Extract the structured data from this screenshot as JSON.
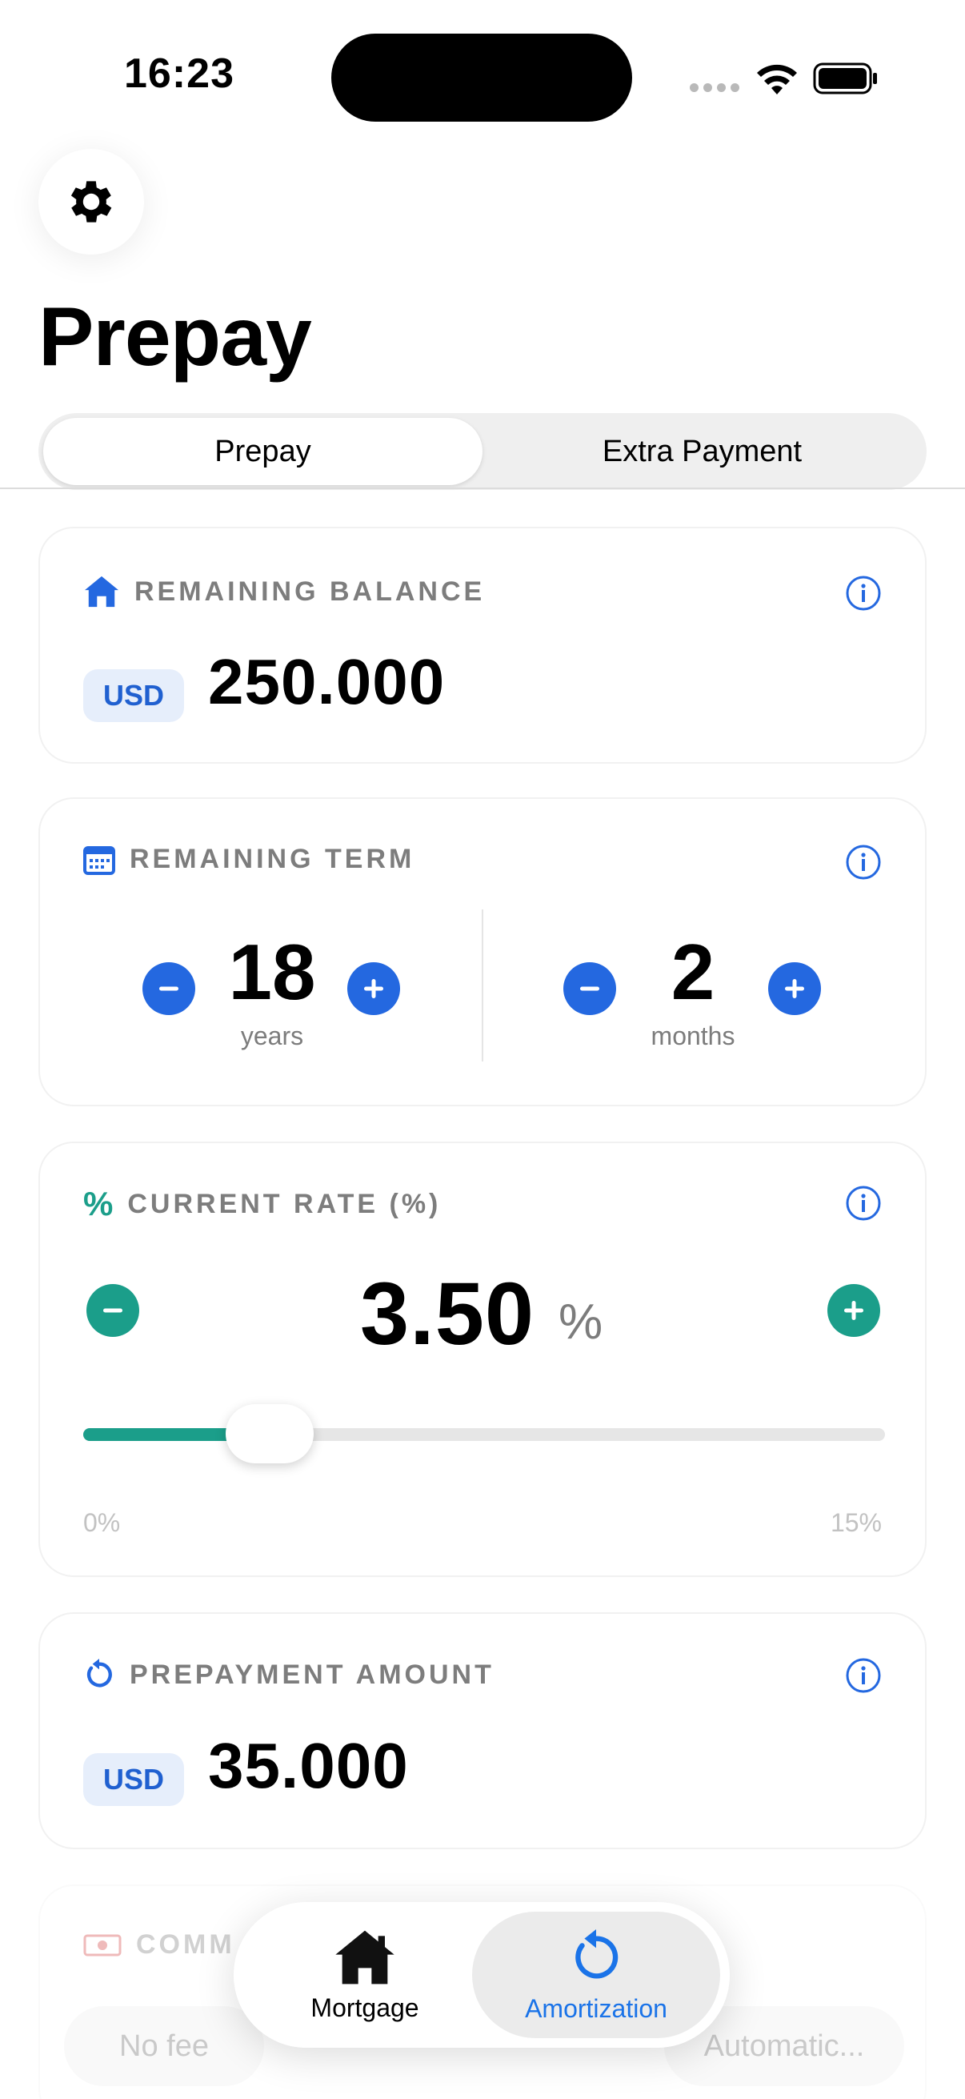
{
  "status_bar": {
    "time": "16:23"
  },
  "header": {
    "settings_icon": "gear-icon",
    "title": "Prepay"
  },
  "segmented_control": {
    "options": [
      "Prepay",
      "Extra Payment"
    ],
    "selected": "Prepay"
  },
  "remaining_balance": {
    "label": "REMAINING BALANCE",
    "icon": "house-icon",
    "currency": "USD",
    "value": "250.000"
  },
  "remaining_term": {
    "label": "REMAINING TERM",
    "icon": "calendar-icon",
    "years": "18",
    "years_label": "years",
    "months": "2",
    "months_label": "months"
  },
  "current_rate": {
    "label": "CURRENT RATE (%)",
    "icon_text": "%",
    "value": "3.50",
    "unit": "%",
    "slider_min": "0%",
    "slider_max": "15%",
    "slider_fraction": 0.233
  },
  "prepayment_amount": {
    "label": "PREPAYMENT AMOUNT",
    "icon": "rotate-icon",
    "currency": "USD",
    "value": "35.000"
  },
  "commission": {
    "label": "COMM",
    "icon": "banknote-icon",
    "option_left": "No fee",
    "option_right": "Automatic..."
  },
  "tab_bar": {
    "tabs": [
      {
        "label": "Mortgage",
        "icon": "house-icon"
      },
      {
        "label": "Amortization",
        "icon": "rotate-icon"
      }
    ],
    "active": "Amortization",
    "accent": "#1a73e8"
  },
  "colors": {
    "blue": "#2468e0",
    "teal": "#1b9e8a"
  }
}
